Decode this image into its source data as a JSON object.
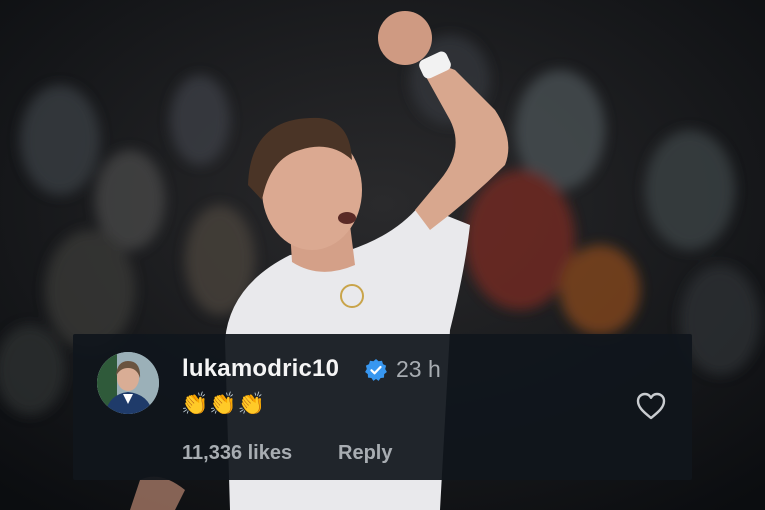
{
  "comment": {
    "username": "lukamodric10",
    "timestamp": "23 h",
    "text": "👏👏👏",
    "likes": "11,336 likes",
    "reply_label": "Reply"
  },
  "icons": {
    "verified": "verified-badge-icon",
    "like": "heart-outline-icon"
  },
  "colors": {
    "card_background": "#10161c",
    "verified_blue": "#3897f0",
    "secondary_text": "#a8adb2",
    "primary_text": "#f5f5f5"
  }
}
